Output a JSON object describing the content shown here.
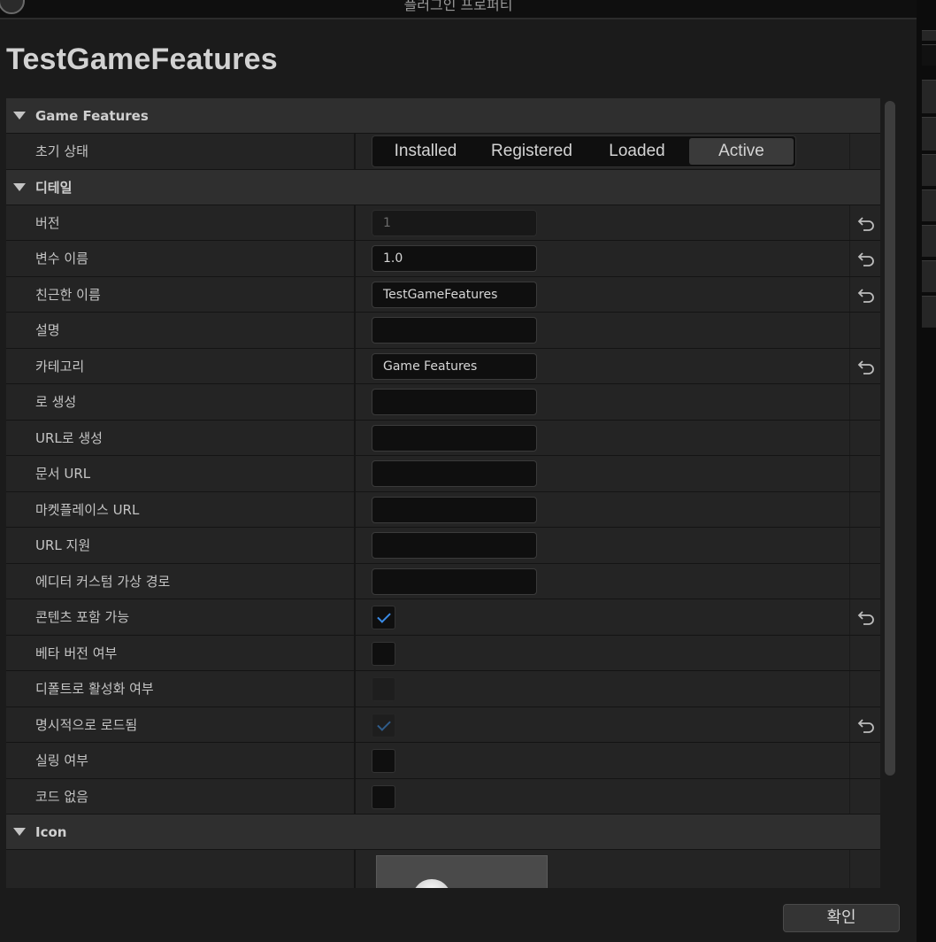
{
  "window": {
    "title": "플러그인 프로퍼티",
    "plugin_name": "TestGameFeatures"
  },
  "sections": {
    "game_features": {
      "label": "Game Features",
      "initial_state": {
        "label": "초기 상태",
        "options": [
          "Installed",
          "Registered",
          "Loaded",
          "Active"
        ],
        "selected": "Active"
      }
    },
    "details": {
      "label": "디테일",
      "version": {
        "label": "버전",
        "value": "1"
      },
      "version_name": {
        "label": "변수 이름",
        "value": "1.0"
      },
      "friendly_name": {
        "label": "친근한 이름",
        "value": "TestGameFeatures"
      },
      "description": {
        "label": "설명",
        "value": ""
      },
      "category": {
        "label": "카테고리",
        "value": "Game Features"
      },
      "created_by": {
        "label": "로 생성",
        "value": ""
      },
      "created_by_url": {
        "label": "URL로 생성",
        "value": ""
      },
      "docs_url": {
        "label": "문서 URL",
        "value": ""
      },
      "marketplace_url": {
        "label": "마켓플레이스 URL",
        "value": ""
      },
      "support_url": {
        "label": "URL 지원",
        "value": ""
      },
      "editor_custom_virtual_path": {
        "label": "에디터 커스텀 가상 경로",
        "value": ""
      },
      "can_contain_content": {
        "label": "콘텐츠 포함 가능",
        "checked": true
      },
      "is_beta": {
        "label": "베타 버전 여부",
        "checked": false
      },
      "enabled_by_default": {
        "label": "디폴트로 활성화 여부",
        "checked": false
      },
      "explicitly_loaded": {
        "label": "명시적으로 로드됨",
        "checked": true
      },
      "is_sealed": {
        "label": "실링 여부",
        "checked": false
      },
      "no_code": {
        "label": "코드 없음",
        "checked": false
      }
    },
    "icon": {
      "label": "Icon"
    }
  },
  "footer": {
    "ok_label": "확인"
  },
  "colors": {
    "accent": "#3a8be6",
    "background": "#1b1b1b"
  }
}
